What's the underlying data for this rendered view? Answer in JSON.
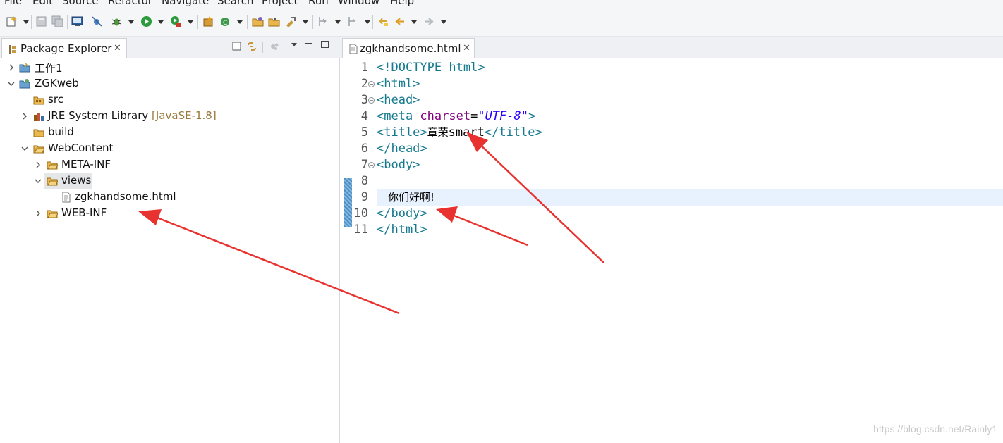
{
  "menu": [
    "File",
    "Edit",
    "Source",
    "Refactor",
    "Navigate",
    "Search",
    "Project",
    "Run",
    "Window",
    "Help"
  ],
  "explorer": {
    "tab_label": "Package Explorer",
    "tree": [
      {
        "label": "工作1",
        "expanded": false
      },
      {
        "label": "ZGKweb",
        "expanded": true
      },
      {
        "label": "src"
      },
      {
        "label": "JRE System Library",
        "decoration": "[JavaSE-1.8]",
        "expanded": false
      },
      {
        "label": "build"
      },
      {
        "label": "WebContent",
        "expanded": true
      },
      {
        "label": "META-INF",
        "expanded": false
      },
      {
        "label": "views",
        "expanded": true,
        "selected": true
      },
      {
        "label": "zgkhandsome.html"
      },
      {
        "label": "WEB-INF",
        "expanded": false
      }
    ]
  },
  "editor": {
    "tab_label": "zgkhandsome.html",
    "line_numbers": [
      "1",
      "2",
      "3",
      "4",
      "5",
      "6",
      "7",
      "8",
      "9",
      "10",
      "11"
    ],
    "lines": {
      "l1": "<!DOCTYPE html>",
      "l2": "<html>",
      "l3": "<head>",
      "l4_open": "<meta ",
      "l4_attr": "charset",
      "l4_eq": "=",
      "l4_val": "\"UTF-8\"",
      "l4_close": ">",
      "l5_open": "<title>",
      "l5_text": "章荣",
      "l5_text2": "smart",
      "l5_close": "</title>",
      "l6": "</head>",
      "l7": "<body>",
      "l9": "你们好啊!",
      "l10": "</body>",
      "l11": "</html>"
    },
    "current_line": 9
  },
  "colors": {
    "tag": "#167a8f",
    "attribute": "#7f007f",
    "string": "#2a00ff",
    "annotation_arrow": "#e8322f",
    "current_line": "#e8f2fe"
  },
  "watermark": "https://blog.csdn.net/Rainly1"
}
